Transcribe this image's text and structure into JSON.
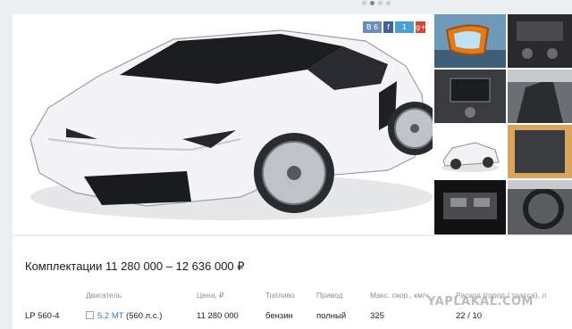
{
  "carousel": {
    "dot_count": 4,
    "active_index": 1
  },
  "share": {
    "buttons": [
      {
        "name": "vk",
        "label": "B 6"
      },
      {
        "name": "fb",
        "label": "f"
      },
      {
        "name": "tw",
        "label": "1"
      },
      {
        "name": "gp",
        "label": "g+"
      }
    ]
  },
  "watermark": "YAPLAKAL.COM",
  "configs": {
    "title": "Комплектации 11 280 000 – 12 636 000 ₽",
    "headers": {
      "engine": "Двигатель",
      "price": "Цена, ₽",
      "fuel": "Топливо",
      "drive": "Привод",
      "speed": "Макс. скор., км/ч",
      "consumption": "Расход (город / трасса), л"
    },
    "rows": [
      {
        "name": "LP 560-4",
        "engine_link": "5.2 MT",
        "engine_power": " (560 л.с.)",
        "price": "11 280 000",
        "fuel": "бензин",
        "drive": "полный",
        "speed": "325",
        "consumption": "22 / 10"
      }
    ]
  },
  "colors": {
    "link": "#3a78c3",
    "page_bg": "#eceef1",
    "accent_orange": "#e07a1c"
  }
}
